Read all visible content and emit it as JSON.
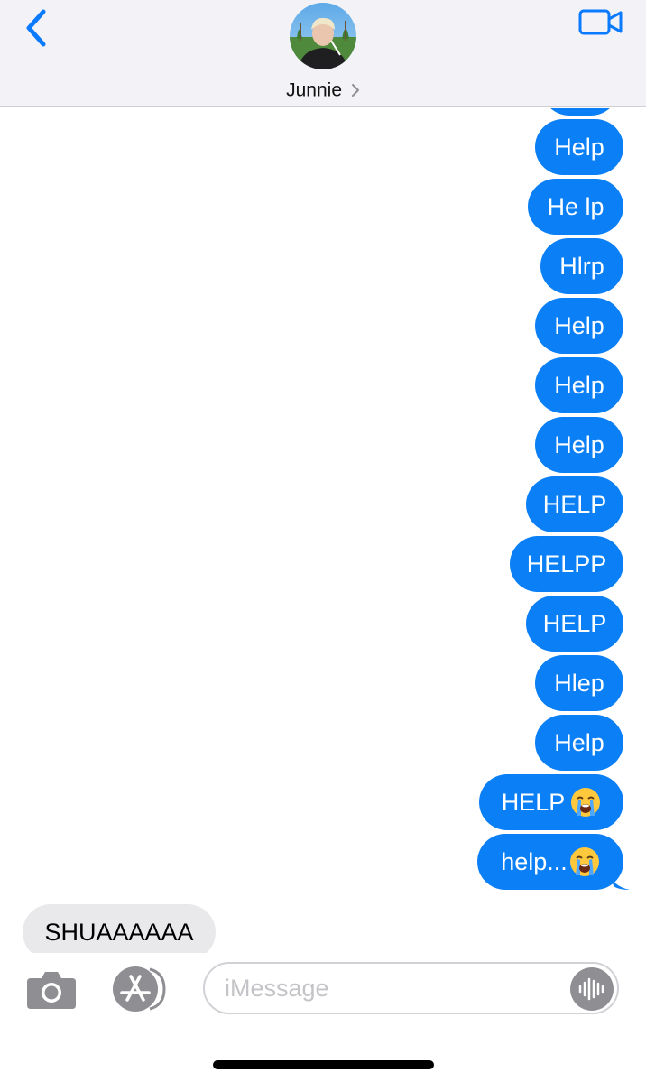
{
  "header": {
    "contact_name": "Junnie",
    "back_icon": "chevron-left-icon",
    "video_icon": "video-camera-icon",
    "accent_color": "#0a7aff"
  },
  "messages": [
    {
      "from": "me",
      "text": ""
    },
    {
      "from": "me",
      "text": "Help"
    },
    {
      "from": "me",
      "text": "He lp"
    },
    {
      "from": "me",
      "text": "Hlrp"
    },
    {
      "from": "me",
      "text": "Help"
    },
    {
      "from": "me",
      "text": "Help"
    },
    {
      "from": "me",
      "text": "Help"
    },
    {
      "from": "me",
      "text": "HELP"
    },
    {
      "from": "me",
      "text": "HELPP"
    },
    {
      "from": "me",
      "text": "HELP"
    },
    {
      "from": "me",
      "text": "Hlep"
    },
    {
      "from": "me",
      "text": "Help"
    },
    {
      "from": "me",
      "text": "HELP",
      "emoji": "loudly-crying-face"
    },
    {
      "from": "me",
      "text": "help...",
      "emoji": "loudly-crying-face"
    },
    {
      "from": "them",
      "text": "SHUAAAAAA"
    }
  ],
  "colors": {
    "sent_bubble": "#0b7ff5",
    "received_bubble": "#e9e9eb",
    "header_bg": "#f2f2f7"
  },
  "input_bar": {
    "placeholder": "iMessage",
    "camera_icon": "camera-icon",
    "apps_icon": "app-store-icon",
    "audio_icon": "audio-waveform-icon"
  }
}
